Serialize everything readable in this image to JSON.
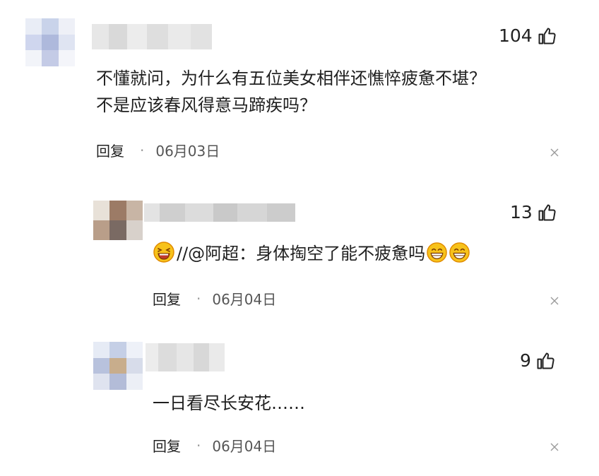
{
  "comments": [
    {
      "likes": "104",
      "lines": [
        "不懂就问，为什么有五位美女相伴还憔悴疲惫不堪？",
        "不是应该春风得意马蹄疾吗？"
      ],
      "reply": "回复",
      "dot": "·",
      "date": "06月03日"
    },
    {
      "likes": "13",
      "prefix": "//@阿超：",
      "body": "身体掏空了能不疲惫吗",
      "reply": "回复",
      "dot": "·",
      "date": "06月04日"
    },
    {
      "likes": "9",
      "body": "一日看尽长安花……",
      "reply": "回复",
      "dot": "·",
      "date": "06月04日"
    }
  ],
  "icons": {
    "like": "thumbs-up-icon",
    "close": "close-icon",
    "emoji_laugh": "laughing-emoji-icon",
    "emoji_grin": "grinning-emoji-icon"
  },
  "colors": {
    "text": "#1f1f1f",
    "meta": "#555555",
    "emoji_face": "#f7c21a",
    "emoji_outline": "#e08a00"
  }
}
